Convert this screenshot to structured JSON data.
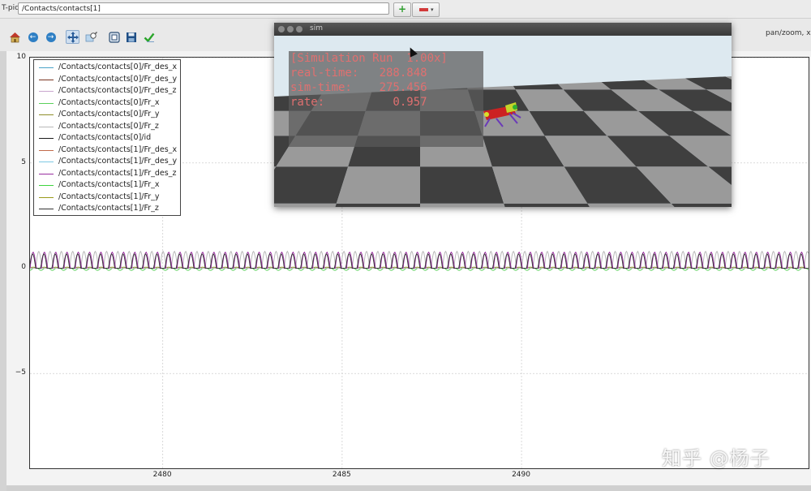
{
  "topbar": {
    "topic_label": "T-pic",
    "topic_value": "/Contacts/contacts[1]",
    "add_label": "+"
  },
  "toolbar": {
    "status": "pan/zoom, x="
  },
  "icons": [
    "home-icon",
    "back-icon",
    "forward-icon",
    "pan-icon",
    "zoom-icon",
    "subplots-icon",
    "save-icon",
    "check-icon"
  ],
  "chart_data": {
    "type": "line",
    "xlim": [
      2476.3,
      2498.0
    ],
    "ylim": [
      -9.5,
      10.0
    ],
    "xticks": [
      2480,
      2485,
      2490
    ],
    "yticks": [
      {
        "value": 10,
        "label": "10"
      },
      {
        "value": 5,
        "label": "5"
      },
      {
        "value": 0,
        "label": "0"
      },
      {
        "value": -5,
        "label": "−5"
      }
    ],
    "grid": true,
    "legend_position": "top-left",
    "legend": [
      {
        "name": "/Contacts/contacts[0]/Fr_des_x",
        "color": "#4aa3c8"
      },
      {
        "name": "/Contacts/contacts[0]/Fr_des_y",
        "color": "#7a3520"
      },
      {
        "name": "/Contacts/contacts[0]/Fr_des_z",
        "color": "#c9a6cf"
      },
      {
        "name": "/Contacts/contacts[0]/Fr_x",
        "color": "#5bd15b"
      },
      {
        "name": "/Contacts/contacts[0]/Fr_y",
        "color": "#8f8f2a"
      },
      {
        "name": "/Contacts/contacts[0]/Fr_z",
        "color": "#b9b9b9"
      },
      {
        "name": "/Contacts/contacts[0]/id",
        "color": "#1a1a1a"
      },
      {
        "name": "/Contacts/contacts[1]/Fr_des_x",
        "color": "#c26a4a"
      },
      {
        "name": "/Contacts/contacts[1]/Fr_des_y",
        "color": "#7ec8e3"
      },
      {
        "name": "/Contacts/contacts[1]/Fr_des_z",
        "color": "#9a2fa0"
      },
      {
        "name": "/Contacts/contacts[1]/Fr_x",
        "color": "#3ed43e"
      },
      {
        "name": "/Contacts/contacts[1]/Fr_y",
        "color": "#9a9a1a"
      },
      {
        "name": "/Contacts/contacts[1]/Fr_z",
        "color": "#333333"
      }
    ],
    "series_shape": {
      "baseline": 0.0,
      "peak": 0.8,
      "period": 0.315,
      "x_start": 2476.3,
      "x_end": 2498.0
    }
  },
  "sim": {
    "title": "sim",
    "hud_lines": [
      "[Simulation Run  1.00x]",
      "real-time:   288.848",
      "sim-time:    275.456",
      "rate:          0.957"
    ]
  },
  "watermark": "知乎 @杨子"
}
